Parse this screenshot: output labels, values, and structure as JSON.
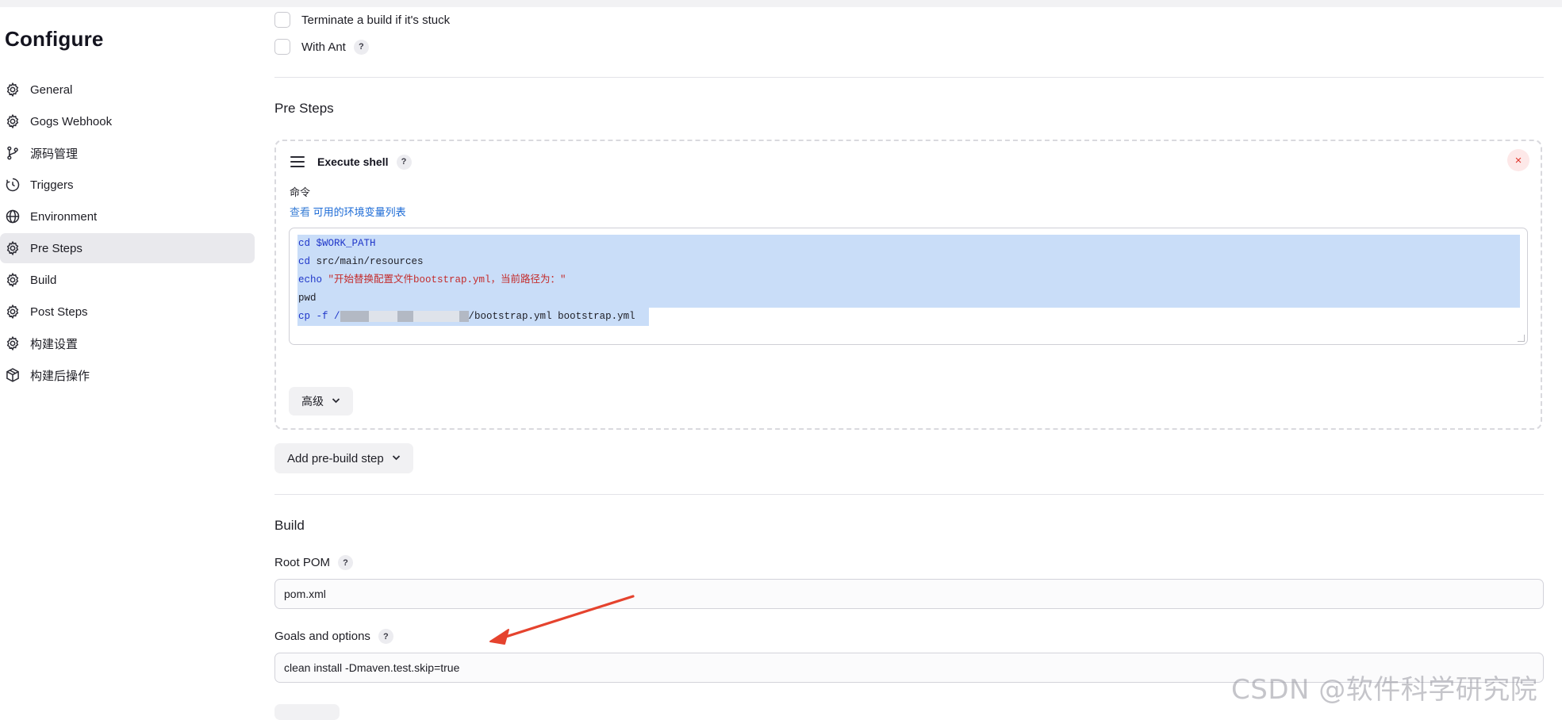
{
  "sidebar": {
    "title": "Configure",
    "items": [
      {
        "label": "General",
        "icon": "gear-icon",
        "active": false
      },
      {
        "label": "Gogs Webhook",
        "icon": "gear-icon",
        "active": false
      },
      {
        "label": "源码管理",
        "icon": "branch-icon",
        "active": false
      },
      {
        "label": "Triggers",
        "icon": "clock-icon",
        "active": false
      },
      {
        "label": "Environment",
        "icon": "globe-icon",
        "active": false
      },
      {
        "label": "Pre Steps",
        "icon": "gear-icon",
        "active": true
      },
      {
        "label": "Build",
        "icon": "gear-icon",
        "active": false
      },
      {
        "label": "Post Steps",
        "icon": "gear-icon",
        "active": false
      },
      {
        "label": "构建设置",
        "icon": "gear-icon",
        "active": false
      },
      {
        "label": "构建后操作",
        "icon": "package-icon",
        "active": false
      }
    ]
  },
  "options": {
    "terminate_stuck": "Terminate a build if it's stuck",
    "with_ant": "With Ant",
    "help_glyph": "?"
  },
  "pre_steps": {
    "title": "Pre Steps",
    "step": {
      "title": "Execute shell",
      "close_glyph": "×",
      "command_label": "命令",
      "env_prefix": "查看",
      "env_link": "可用的环境变量列表",
      "code": {
        "line1_kw": "cd",
        "line1_var": "$WORK_PATH",
        "line2_kw": "cd",
        "line2_rest": "src/main/resources",
        "line3_kw": "echo",
        "line3_str": "\"开始替换配置文件bootstrap.yml，当前路径为：\"",
        "line4": "pwd",
        "line5_kw": "cp",
        "line5_flag": "-f /",
        "line5_rest": "/bootstrap.yml bootstrap.yml"
      },
      "advanced_label": "高级"
    },
    "add_step_label": "Add pre-build step"
  },
  "build": {
    "title": "Build",
    "root_pom_label": "Root POM",
    "root_pom_value": "pom.xml",
    "goals_label": "Goals and options",
    "goals_value": "clean install -Dmaven.test.skip=true"
  },
  "watermark": "CSDN @软件科学研究院",
  "colors": {
    "accent_link": "#1b6ad6",
    "selection": "#c9ddf8",
    "arrow": "#e5432e",
    "close": "#e0352b"
  }
}
